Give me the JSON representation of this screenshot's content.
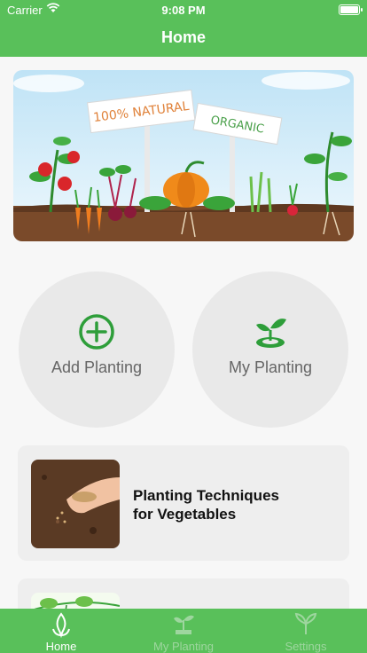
{
  "status_bar": {
    "carrier": "Carrier",
    "time": "9:08 PM"
  },
  "nav": {
    "title": "Home"
  },
  "banner": {
    "sign1": "100% NATURAL",
    "sign2": "ORGANIC"
  },
  "actions": {
    "add_planting": "Add Planting",
    "my_planting": "My Planting"
  },
  "cards": [
    {
      "line1": "Planting Techniques",
      "line2": "for Vegetables"
    }
  ],
  "tabs": [
    {
      "label": "Home",
      "active": true
    },
    {
      "label": "My Planting",
      "active": false
    },
    {
      "label": "Settings",
      "active": false
    }
  ],
  "colors": {
    "brand_green": "#59c05a",
    "icon_green": "#2e9e3a",
    "card_bg": "#eeeeee"
  }
}
